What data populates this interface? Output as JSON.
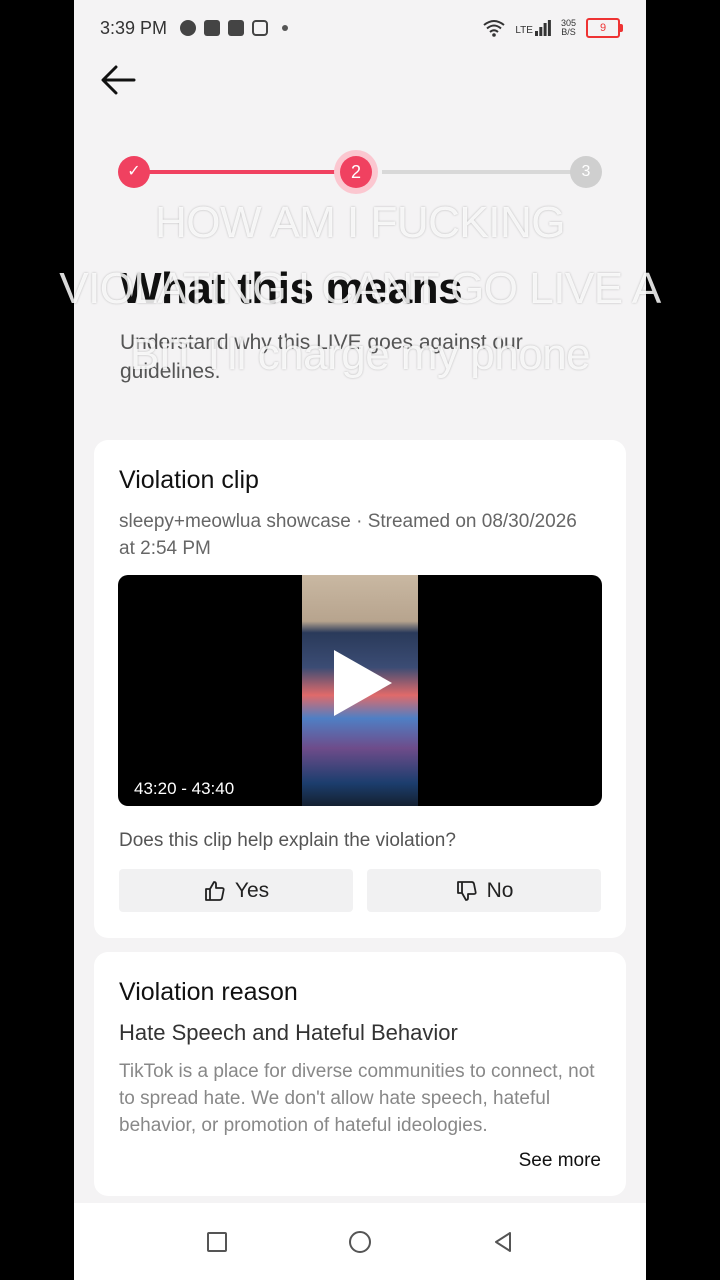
{
  "status_bar": {
    "time": "3:39 PM",
    "network": "LTE",
    "speed_top": "305",
    "speed_bottom": "B/S",
    "battery": "9"
  },
  "stepper": {
    "step1": "✓",
    "step2": "2",
    "step3": "3"
  },
  "page": {
    "title": "What this means",
    "subtitle": "Understand why this LIVE goes against our guidelines."
  },
  "clip_card": {
    "title": "Violation clip",
    "meta": "sleepy+meowlua showcase · Streamed on 08/30/2026 at 2:54 PM",
    "timestamp": "43:20 - 43:40",
    "question": "Does this clip help explain the violation?",
    "yes_label": "Yes",
    "no_label": "No"
  },
  "reason_card": {
    "title": "Violation reason",
    "subtitle": "Hate Speech and Hateful Behavior",
    "body": "TikTok is a place for diverse communities to connect, not to spread hate. We don't allow hate speech, hateful behavior, or promotion of hateful ideologies.",
    "see_more": "See more"
  },
  "overlay_caption": {
    "line1": "HOW AM I FUCKING",
    "line2": "VIOLATING I CANT GO LIVE A",
    "line3": "BIT I'll charge my phone"
  },
  "colors": {
    "accent": "#f04160",
    "background": "#f4f3f4",
    "card": "#ffffff"
  }
}
